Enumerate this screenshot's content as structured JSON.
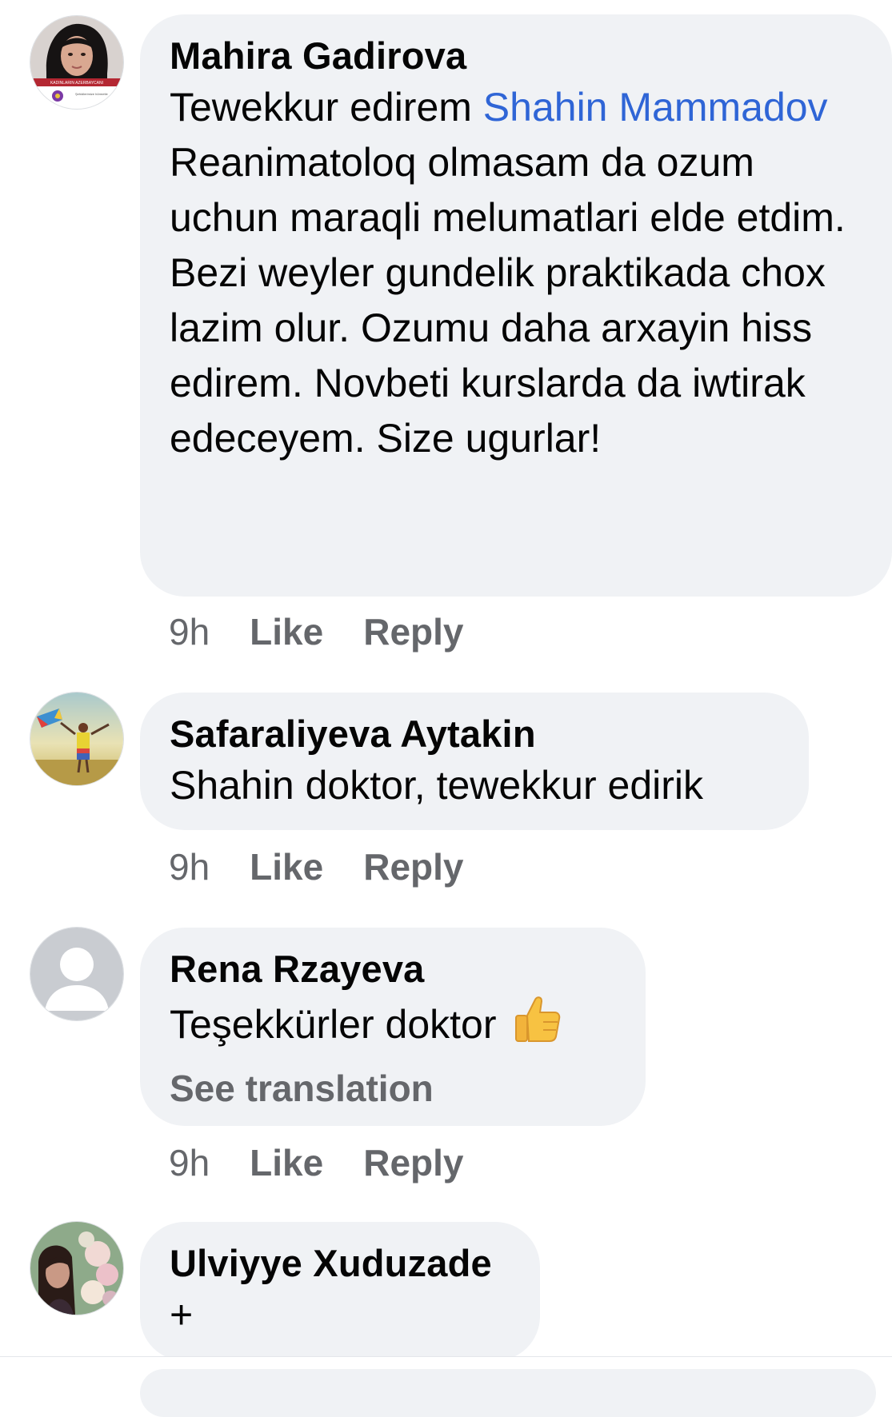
{
  "comments": [
    {
      "name": "Mahira Gadirova",
      "text_prefix": "Tewekkur edirem ",
      "mention": "Shahin Mammadov",
      "text_body": "Reanimatoloq olmasam da ozum uchun maraqli melumatlari elde etdim. Bezi weyler gundelik praktikada chox lazim olur. Ozumu daha arxayin hiss edirem. Novbeti kurslarda da iwtirak edeceyem. Size ugurlar!",
      "avatar_logo_text": "KADINLARIN AZERBAYCANI",
      "avatar_caption": "Şehidlerimize hörmetle",
      "time": "9h",
      "like_label": "Like",
      "reply_label": "Reply"
    },
    {
      "name": "Safaraliyeva Aytakin",
      "text": "Shahin doktor, tewekkur edirik",
      "time": "9h",
      "like_label": "Like",
      "reply_label": "Reply"
    },
    {
      "name": "Rena Rzayeva",
      "text": "Teşekkürler doktor",
      "emoji": "thumbs-up-icon",
      "see_translation": "See translation",
      "time": "9h",
      "like_label": "Like",
      "reply_label": "Reply"
    },
    {
      "name": "Ulviyye Xuduzade",
      "text": "+"
    }
  ],
  "colors": {
    "bubble_bg": "#f0f2f5",
    "mention": "#2f65d6",
    "meta_gray": "#65676b",
    "text": "#050505"
  }
}
